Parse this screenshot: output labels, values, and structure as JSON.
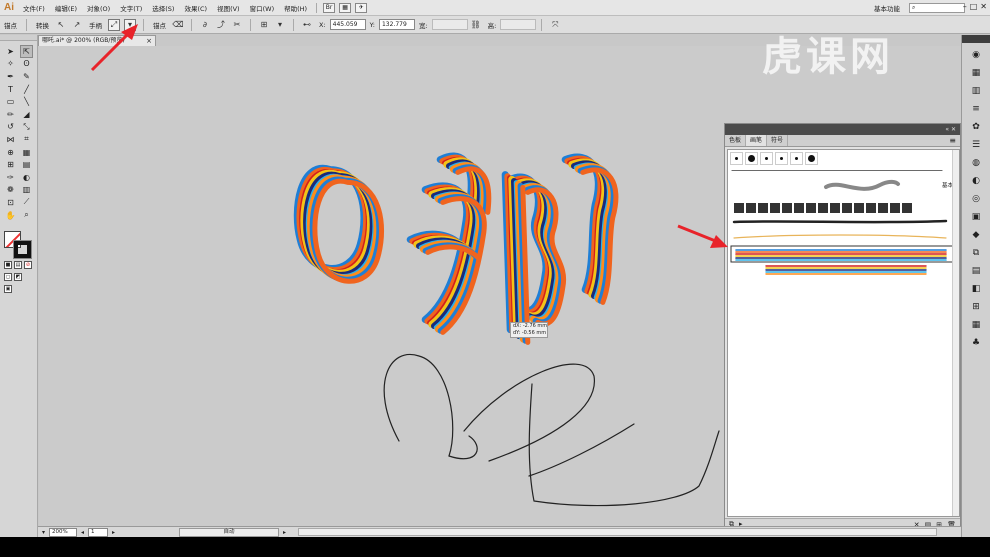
{
  "app": {
    "logo": "Ai"
  },
  "menubar": {
    "items": [
      "文件(F)",
      "编辑(E)",
      "对象(O)",
      "文字(T)",
      "选择(S)",
      "效果(C)",
      "视图(V)",
      "窗口(W)",
      "帮助(H)"
    ],
    "workspace": "基本功能",
    "search_icon": "search-icon"
  },
  "controlbar": {
    "anchor_label": "锚点",
    "convert_label": "转换",
    "handle_label": "手柄",
    "anchors_label": "锚点",
    "x_label": "X:",
    "x_value": "445.059",
    "y_label": "Y:",
    "y_value": "132.779",
    "w_label": "宽:",
    "h_label": "高:"
  },
  "document": {
    "tab_title": "哪吒.ai* @ 200% (RGB/预览)",
    "tab_close": "×"
  },
  "tooltip": {
    "dx": "dX: -2.76 mm",
    "dy": "dY: -0.56 mm"
  },
  "watermark": "虎课网",
  "brush_panel": {
    "tabs": [
      "色板",
      "画笔",
      "符号"
    ],
    "active_tab": 1,
    "basic_label": "基本",
    "dot_sizes": [
      1,
      3,
      1,
      1,
      1,
      3
    ]
  },
  "statusbar": {
    "zoom": "200%",
    "page": "1",
    "status": "自动"
  },
  "colors": {
    "accent_arrow": "#e8232a",
    "canvas_bg": "#cbcbcb",
    "stroke_blue": "#1f7fd6",
    "stroke_orange": "#f0641e",
    "stroke_red": "#d21e1e",
    "stroke_yellow": "#f2c318"
  }
}
